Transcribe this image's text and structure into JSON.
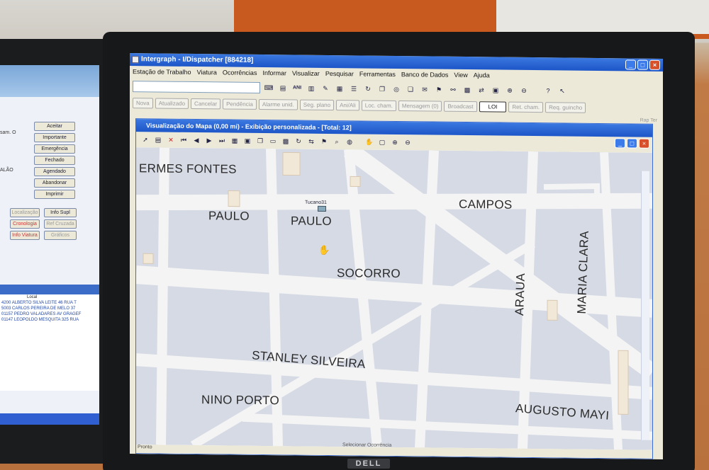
{
  "app": {
    "title": "Intergraph - I/Dispatcher [884218]",
    "menu": [
      "Estação de Trabalho",
      "Viatura",
      "Ocorrências",
      "Informar",
      "Visualizar",
      "Pesquisar",
      "Ferramentas",
      "Banco de Dados",
      "View",
      "Ajuda"
    ],
    "action_buttons": [
      {
        "label": "Nova",
        "active": false
      },
      {
        "label": "Atualizado",
        "active": false
      },
      {
        "label": "Cancelar",
        "active": false
      },
      {
        "label": "Pendência",
        "active": false
      },
      {
        "label": "Alarme unid.",
        "active": false
      },
      {
        "label": "Seg. plano",
        "active": false
      },
      {
        "label": "Ani/Ali",
        "active": false
      },
      {
        "label": "Loc. cham.",
        "active": false
      },
      {
        "label": "Mensagem (0)",
        "active": false
      },
      {
        "label": "Broadcast",
        "active": false
      },
      {
        "label": "LOI",
        "active": true
      },
      {
        "label": "Ret. cham.",
        "active": false
      },
      {
        "label": "Req. guincho",
        "active": false
      }
    ],
    "rap_ter": "Rap Ter"
  },
  "map_window": {
    "title": "Visualização do Mapa (0,00 mi) - Exibição personalizada - [Total: 12]",
    "status_left": "Pronto",
    "status_bottom": "Selecionar Ocorrência"
  },
  "map_labels": {
    "ermes_fontes": "ERMES FONTES",
    "paulo1": "PAULO",
    "paulo2": "PAULO",
    "campos": "CAMPOS",
    "socorro": "SOCORRO",
    "araua": "ARAUA",
    "maria_clara": "MARIA CLARA",
    "stanley": "STANLEY SILVEIRA",
    "nino": "NINO PORTO",
    "augusto": "AUGUSTO MAYI",
    "unit": "Tucano31"
  },
  "left_screen": {
    "buttons": [
      "Aceitar",
      "Importante",
      "Emergência",
      "Fechado",
      "Agendado",
      "Abandonar",
      "Imprimir"
    ],
    "lower_buttons": [
      "Localização",
      "Info Supl",
      "Cronologia",
      "Ref Cruzada",
      "Info Viatura",
      "Gráficos"
    ],
    "fields": [
      "sam. O",
      "ALÃO"
    ],
    "list_header": "Local",
    "list_rows": [
      {
        "id": "4200",
        "text": "ALBERTO SILVA LEITE 46 RUA T"
      },
      {
        "id": "5003",
        "text": "CARLOS PEREIRA DE MELO 37"
      },
      {
        "id": "01157",
        "text": "PEDRO VALADARES AV GRAGEF"
      },
      {
        "id": "01147",
        "text": "LEOPOLDO MESQUITA 325 RUA"
      }
    ]
  },
  "brand": "DELL"
}
